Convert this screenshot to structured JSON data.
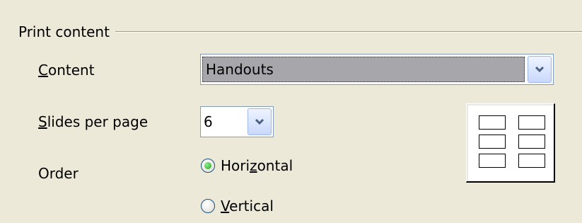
{
  "print_content": {
    "group_title": "Print content",
    "content": {
      "label_mnemonic": "C",
      "label_rest": "ontent",
      "value": "Handouts"
    },
    "slides_per_page": {
      "label_mnemonic": "S",
      "label_rest": "lides per page",
      "value": "6"
    },
    "order": {
      "label": "Order",
      "horizontal": {
        "label_pre": "Hori",
        "label_mnemonic": "z",
        "label_post": "ontal",
        "checked": true
      },
      "vertical": {
        "label_pre": "",
        "label_mnemonic": "V",
        "label_post": "ertical",
        "checked": false
      }
    },
    "preview": {
      "rows": 3,
      "columns": 2
    }
  },
  "icons": {
    "dropdown": "chevron-down-icon",
    "radio": "radio-button",
    "preview": "slide-layout-preview"
  },
  "colors": {
    "dialog_background": "#ECE9D8",
    "selection_highlight": "#A7A6AA",
    "radio_checked": "#21A121",
    "combo_border": "#7F9DB9"
  }
}
